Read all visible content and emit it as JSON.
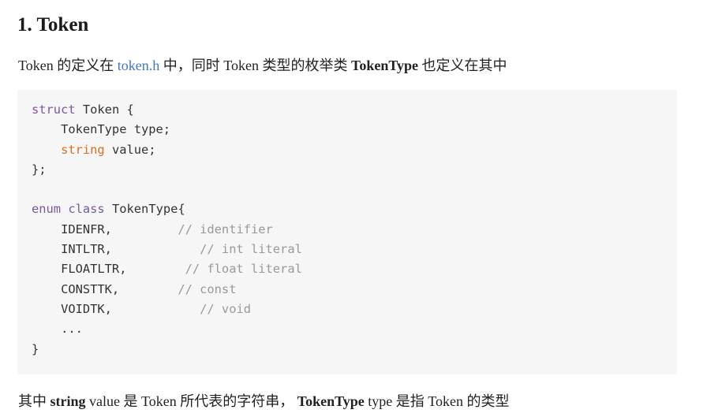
{
  "heading": "1. Token",
  "intro": {
    "prefix": "Token 的定义在 ",
    "link": "token.h",
    "middle": " 中，同时 Token 类型的枚举类 ",
    "bold": "TokenType",
    "suffix": " 也定义在其中"
  },
  "code": {
    "lines": [
      [
        {
          "t": "struct",
          "s": "keyword"
        },
        {
          "t": " Token {",
          "s": "plain"
        }
      ],
      [
        {
          "t": "    TokenType type;",
          "s": "plain"
        }
      ],
      [
        {
          "t": "    ",
          "s": "plain"
        },
        {
          "t": "string",
          "s": "type"
        },
        {
          "t": " value;",
          "s": "plain"
        }
      ],
      [
        {
          "t": "};",
          "s": "plain"
        }
      ],
      [
        {
          "t": "",
          "s": "plain"
        }
      ],
      [
        {
          "t": "enum",
          "s": "keyword"
        },
        {
          "t": " ",
          "s": "plain"
        },
        {
          "t": "class",
          "s": "keyword"
        },
        {
          "t": " TokenType{",
          "s": "plain"
        }
      ],
      [
        {
          "t": "    IDENFR,         ",
          "s": "plain"
        },
        {
          "t": "// identifier",
          "s": "comment"
        }
      ],
      [
        {
          "t": "    INTLTR,            ",
          "s": "plain"
        },
        {
          "t": "// int literal",
          "s": "comment"
        }
      ],
      [
        {
          "t": "    FLOATLTR,        ",
          "s": "plain"
        },
        {
          "t": "// float literal",
          "s": "comment"
        }
      ],
      [
        {
          "t": "    CONSTTK,        ",
          "s": "plain"
        },
        {
          "t": "// const",
          "s": "comment"
        }
      ],
      [
        {
          "t": "    VOIDTK,            ",
          "s": "plain"
        },
        {
          "t": "// void",
          "s": "comment"
        }
      ],
      [
        {
          "t": "    ...",
          "s": "plain"
        }
      ],
      [
        {
          "t": "}",
          "s": "plain"
        }
      ]
    ]
  },
  "outro": {
    "prefix": "其中 ",
    "bold1": "string",
    "part2": " value 是 Token 所代表的字符串， ",
    "bold2": "TokenType",
    "suffix": " type 是指 Token 的类型"
  },
  "colors": {
    "keyword": "#7a5a9a",
    "type": "#e06c1f",
    "comment": "#999999",
    "link": "#4078c0",
    "code_bg": "#f6f6f6"
  }
}
